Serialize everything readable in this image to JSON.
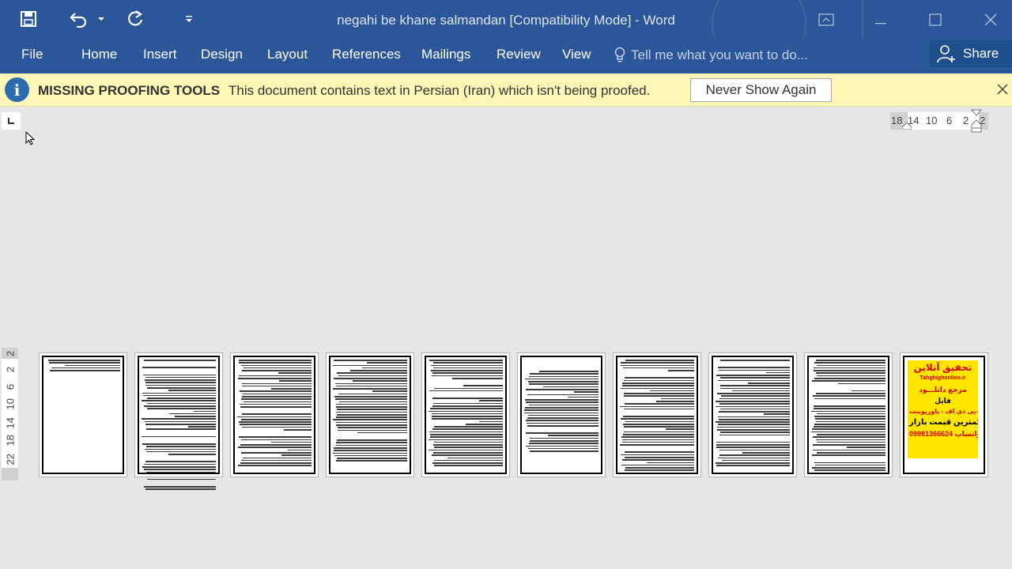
{
  "window": {
    "title": "negahi be khane salmandan [Compatibility Mode] - Word"
  },
  "qat": {
    "save_icon": "save-icon",
    "undo_icon": "undo-icon",
    "redo_icon": "redo-icon",
    "customize_icon": "customize-qat-icon"
  },
  "ribbon": {
    "tabs": [
      "File",
      "Home",
      "Insert",
      "Design",
      "Layout",
      "References",
      "Mailings",
      "Review",
      "View"
    ],
    "tell_me_placeholder": "Tell me what you want to do...",
    "share_label": "Share"
  },
  "message_bar": {
    "title": "MISSING PROOFING TOOLS",
    "text": "This document contains text in Persian (Iran) which isn't being proofed.",
    "button_label": "Never Show Again"
  },
  "rulers": {
    "horizontal_ticks": [
      "18",
      "14",
      "10",
      "6",
      "2",
      "2"
    ],
    "vertical_ticks": [
      "2",
      "2",
      "6",
      "10",
      "14",
      "18",
      "22"
    ]
  },
  "pages": {
    "count": 10,
    "ad_lines": [
      "تحقیق آنلاین",
      "Tahghighonline.ir",
      "مرجع دانلـــود",
      "فایل",
      "ورد-پی دی اف - پاورپوینت",
      "با کمترین قیمت بازار",
      "09981366624 واتساپ"
    ]
  },
  "colors": {
    "titlebar": "#2b579a",
    "message_bar": "#fcf7b6",
    "canvas": "#e6e6e6",
    "ad_background": "#ffe600"
  }
}
